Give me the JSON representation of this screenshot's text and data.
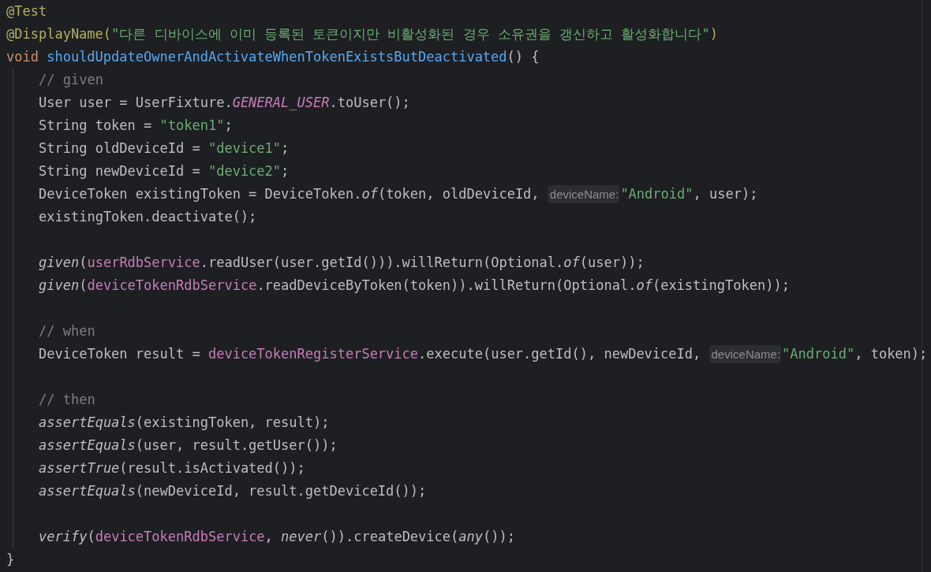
{
  "code": [
    {
      "tokens": [
        {
          "kind": "annotation",
          "text": "@Test"
        }
      ]
    },
    {
      "tokens": [
        {
          "kind": "annotation",
          "text": "@DisplayName("
        },
        {
          "kind": "string",
          "text": "\"다른 디바이스에 이미 등록된 토큰이지만 비활성화된 경우 소유권을 갱신하고 활성화합니다\""
        },
        {
          "kind": "annotation",
          "text": ")"
        }
      ]
    },
    {
      "tokens": [
        {
          "kind": "keyword",
          "text": "void "
        },
        {
          "kind": "declaration",
          "text": "shouldUpdateOwnerAndActivateWhenTokenExistsButDeactivated"
        },
        {
          "kind": "plain",
          "text": "() {"
        }
      ],
      "children": [
        {
          "tokens": [
            {
              "kind": "comment",
              "text": "// given"
            }
          ]
        },
        {
          "tokens": [
            {
              "kind": "plain",
              "text": "User user = UserFixture."
            },
            {
              "kind": "static_field",
              "text": "GENERAL_USER"
            },
            {
              "kind": "plain",
              "text": ".toUser();"
            }
          ]
        },
        {
          "tokens": [
            {
              "kind": "plain",
              "text": "String token = "
            },
            {
              "kind": "string",
              "text": "\"token1\""
            },
            {
              "kind": "plain",
              "text": ";"
            }
          ]
        },
        {
          "tokens": [
            {
              "kind": "plain",
              "text": "String oldDeviceId = "
            },
            {
              "kind": "string",
              "text": "\"device1\""
            },
            {
              "kind": "plain",
              "text": ";"
            }
          ]
        },
        {
          "tokens": [
            {
              "kind": "plain",
              "text": "String newDeviceId = "
            },
            {
              "kind": "string",
              "text": "\"device2\""
            },
            {
              "kind": "plain",
              "text": ";"
            }
          ]
        },
        {
          "tokens": [
            {
              "kind": "plain",
              "text": "DeviceToken existingToken = DeviceToken."
            },
            {
              "kind": "static_call",
              "text": "of"
            },
            {
              "kind": "plain",
              "text": "(token, oldDeviceId, "
            },
            {
              "kind": "hint",
              "text": "deviceName:"
            },
            {
              "kind": "string",
              "text": "\"Android\""
            },
            {
              "kind": "plain",
              "text": ", user);"
            }
          ]
        },
        {
          "tokens": [
            {
              "kind": "plain",
              "text": "existingToken.deactivate();"
            }
          ]
        },
        {
          "blank_before": true,
          "tokens": [
            {
              "kind": "static_call",
              "text": "given"
            },
            {
              "kind": "plain",
              "text": "("
            },
            {
              "kind": "field",
              "text": "userRdbService"
            },
            {
              "kind": "plain",
              "text": ".readUser(user.getId())).willReturn(Optional."
            },
            {
              "kind": "static_call",
              "text": "of"
            },
            {
              "kind": "plain",
              "text": "(user));"
            }
          ]
        },
        {
          "tokens": [
            {
              "kind": "static_call",
              "text": "given"
            },
            {
              "kind": "plain",
              "text": "("
            },
            {
              "kind": "field",
              "text": "deviceTokenRdbService"
            },
            {
              "kind": "plain",
              "text": ".readDeviceByToken(token)).willReturn(Optional."
            },
            {
              "kind": "static_call",
              "text": "of"
            },
            {
              "kind": "plain",
              "text": "(existingToken));"
            }
          ]
        },
        {
          "blank_before": true,
          "tokens": [
            {
              "kind": "comment",
              "text": "// when"
            }
          ]
        },
        {
          "tokens": [
            {
              "kind": "plain",
              "text": "DeviceToken result = "
            },
            {
              "kind": "field",
              "text": "deviceTokenRegisterService"
            },
            {
              "kind": "plain",
              "text": ".execute(user.getId(), newDeviceId, "
            },
            {
              "kind": "hint",
              "text": "deviceName:"
            },
            {
              "kind": "string",
              "text": "\"Android\""
            },
            {
              "kind": "plain",
              "text": ", token);"
            }
          ]
        },
        {
          "blank_before": true,
          "tokens": [
            {
              "kind": "comment",
              "text": "// then"
            }
          ]
        },
        {
          "tokens": [
            {
              "kind": "static_call",
              "text": "assertEquals"
            },
            {
              "kind": "plain",
              "text": "(existingToken, result);"
            }
          ]
        },
        {
          "tokens": [
            {
              "kind": "static_call",
              "text": "assertEquals"
            },
            {
              "kind": "plain",
              "text": "(user, result.getUser());"
            }
          ]
        },
        {
          "tokens": [
            {
              "kind": "static_call",
              "text": "assertTrue"
            },
            {
              "kind": "plain",
              "text": "(result.isActivated());"
            }
          ]
        },
        {
          "tokens": [
            {
              "kind": "static_call",
              "text": "assertEquals"
            },
            {
              "kind": "plain",
              "text": "(newDeviceId, result.getDeviceId());"
            }
          ]
        },
        {
          "blank_before": true,
          "tokens": [
            {
              "kind": "static_call",
              "text": "verify"
            },
            {
              "kind": "plain",
              "text": "("
            },
            {
              "kind": "field",
              "text": "deviceTokenRdbService"
            },
            {
              "kind": "plain",
              "text": ", "
            },
            {
              "kind": "static_call",
              "text": "never"
            },
            {
              "kind": "plain",
              "text": "()).createDevice("
            },
            {
              "kind": "static_call",
              "text": "any"
            },
            {
              "kind": "plain",
              "text": "());"
            }
          ]
        }
      ]
    },
    {
      "tokens": [
        {
          "kind": "plain",
          "text": "}"
        }
      ]
    }
  ]
}
